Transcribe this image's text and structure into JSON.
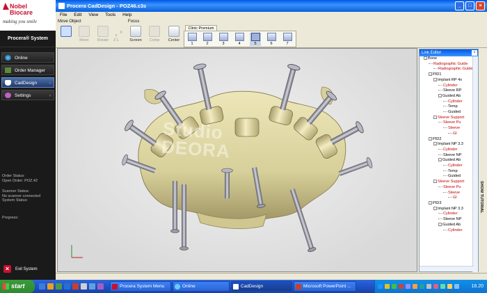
{
  "sidebar": {
    "brand": "Nobel\nBiocare",
    "tagline": "making you smile",
    "title": "Procera® System",
    "nav": [
      {
        "label": "Online"
      },
      {
        "label": "Order Manager"
      },
      {
        "label": "CadDesign",
        "active": true
      },
      {
        "label": "Settings"
      }
    ],
    "status": {
      "order_label": "Order Status:",
      "order_value": "Open Order: POZ.42",
      "scanner_label": "Scanner Status:",
      "scanner_value": "No scanner connected",
      "system_label": "System Status:",
      "progress_label": "Progress:"
    },
    "exit_label": "Exit System"
  },
  "window": {
    "title": "Procera CadDesign  -  POZ46.c3s",
    "menu": [
      "File",
      "Edit",
      "View",
      "Tools",
      "Help"
    ]
  },
  "toolbar": {
    "move_object_label": "Move Object",
    "move_buttons": [
      {
        "label": "",
        "icon": "select-object-icon",
        "selected": true
      },
      {
        "label": "Move",
        "icon": "move-arrows-icon",
        "disabled": true
      },
      {
        "label": "Rotate",
        "icon": "rotate-icon",
        "disabled": true
      },
      {
        "label": "X\nY\nZ L",
        "icon": "axis-icon",
        "disabled": true
      }
    ],
    "focus_label": "Focus",
    "focus_buttons": [
      {
        "label": "Screen",
        "icon": "screen-focus-icon"
      },
      {
        "label": "Comp",
        "icon": "component-focus-icon",
        "disabled": true
      },
      {
        "label": "Center",
        "icon": "center-focus-icon"
      }
    ],
    "clinic_tab": "Clinic Premium",
    "clinic_buttons": [
      {
        "label": "1"
      },
      {
        "label": "2"
      },
      {
        "label": "3"
      },
      {
        "label": "4"
      },
      {
        "label": "5",
        "selected": true
      },
      {
        "label": "6"
      },
      {
        "label": "7"
      }
    ]
  },
  "viewport": {
    "watermark": "Studio\nDEORA"
  },
  "link_editor": {
    "title": "Link Editor",
    "tree": [
      {
        "text": "Bone",
        "level": 0,
        "exp": "-"
      },
      {
        "text": "Radiographic Guide",
        "level": 1,
        "red": true
      },
      {
        "text": "Radiographic Guide",
        "level": 2,
        "red": true
      },
      {
        "text": "PID1",
        "level": 1,
        "exp": "-"
      },
      {
        "text": "Implant RP 4x",
        "level": 2,
        "exp": "-"
      },
      {
        "text": "Cylinder",
        "level": 3,
        "red": true
      },
      {
        "text": "Sleeve RP",
        "level": 3
      },
      {
        "text": "Guided Ab",
        "level": 3,
        "exp": "-"
      },
      {
        "text": "Cylinder",
        "level": 4,
        "red": true
      },
      {
        "text": "Temp",
        "level": 4
      },
      {
        "text": "Guided",
        "level": 4
      },
      {
        "text": "Sleeve Support",
        "level": 2,
        "exp": "-",
        "red": true
      },
      {
        "text": "Sleeve Pu",
        "level": 3,
        "red": true
      },
      {
        "text": "Sleeve",
        "level": 4,
        "red": true
      },
      {
        "text": "Gl",
        "level": 5,
        "red": true
      },
      {
        "text": "PID2",
        "level": 1,
        "exp": "-"
      },
      {
        "text": "Implant NP 3.3",
        "level": 2,
        "exp": "-"
      },
      {
        "text": "Cylinder",
        "level": 3,
        "red": true
      },
      {
        "text": "Sleeve NP",
        "level": 3
      },
      {
        "text": "Guided Ab",
        "level": 3,
        "exp": "-"
      },
      {
        "text": "Cylinder",
        "level": 4,
        "red": true
      },
      {
        "text": "Temp",
        "level": 4
      },
      {
        "text": "Guided",
        "level": 4
      },
      {
        "text": "Sleeve Support",
        "level": 2,
        "exp": "-",
        "red": true
      },
      {
        "text": "Sleeve Pu",
        "level": 3,
        "red": true
      },
      {
        "text": "Sleeve",
        "level": 4,
        "red": true
      },
      {
        "text": "Gl",
        "level": 5,
        "red": true
      },
      {
        "text": "PID3",
        "level": 1,
        "exp": "-"
      },
      {
        "text": "Implant NP 3.3",
        "level": 2,
        "exp": "-"
      },
      {
        "text": "Cylinder",
        "level": 3,
        "red": true
      },
      {
        "text": "Sleeve NP",
        "level": 3
      },
      {
        "text": "Guided Ab",
        "level": 3,
        "exp": "-"
      },
      {
        "text": "Cylinder",
        "level": 4,
        "red": true
      }
    ],
    "side_tab": "SHOW TUTORIAL"
  },
  "taskbar": {
    "start_label": "start",
    "tasks": [
      {
        "label": "Procera System Menu"
      },
      {
        "label": "Online"
      },
      {
        "label": "CadDesign",
        "active": true
      },
      {
        "label": "Microsoft PowerPoint ..."
      }
    ],
    "clock": "16.20"
  },
  "colors": {
    "bone": "#e0d9a6",
    "bone_shadow": "#8e8555",
    "sleeve": "#e7dca6",
    "pin": "#9a9aa6",
    "title_blue": "#0058e6",
    "link_red": "#c00000"
  }
}
